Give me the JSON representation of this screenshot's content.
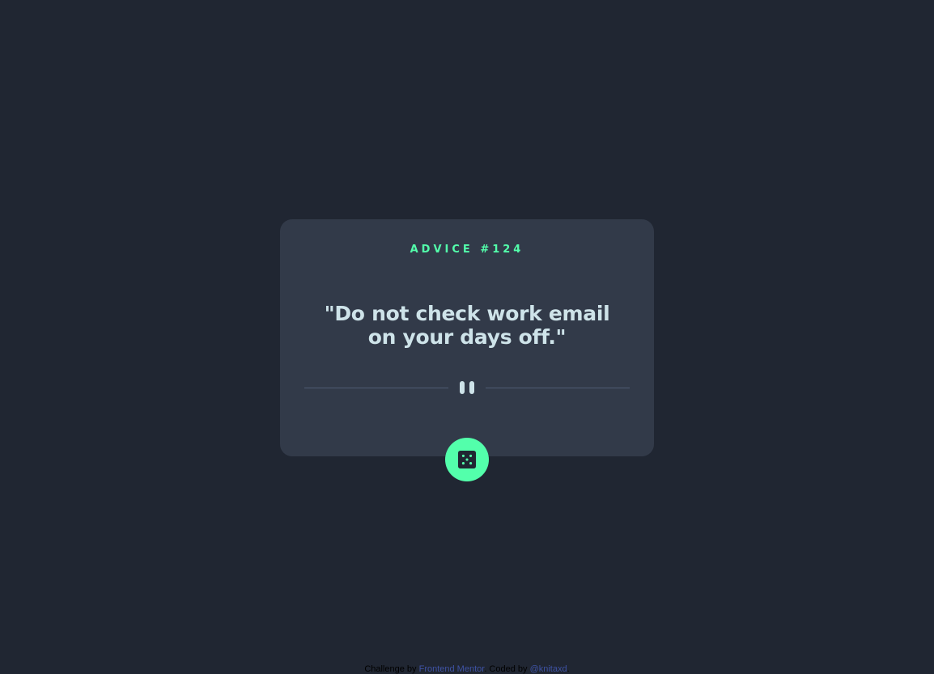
{
  "advice": {
    "heading": "ADVICE #124",
    "text": "\"Do not check work email on your days off.\""
  },
  "divider": {
    "icon": "pause-icon"
  },
  "generate_button": {
    "icon": "dice-icon"
  },
  "footer": {
    "prefix": "Challenge by ",
    "challenge_link": "Frontend Mentor",
    "middle": ". Coded by ",
    "author_link": "@knitaxd",
    "suffix": "."
  },
  "colors": {
    "background": "#202632",
    "card": "#323a49",
    "accent": "#53ffab",
    "text": "#cee3e9",
    "divider": "#4f5d74",
    "link": "#3e52a3"
  }
}
